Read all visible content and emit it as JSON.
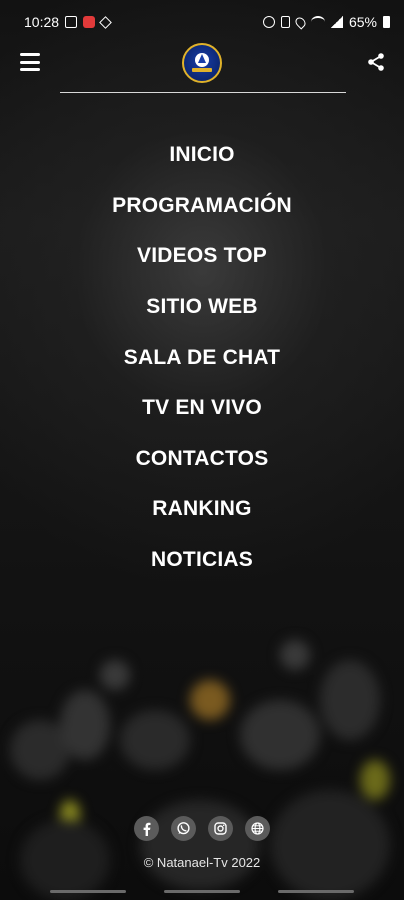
{
  "status_bar": {
    "time": "10:28",
    "battery": "65%"
  },
  "toolbar": {
    "menu_icon": "hamburger-menu-icon",
    "logo_icon": "natanael-tv-logo",
    "share_icon": "share-icon"
  },
  "menu": {
    "items": [
      {
        "label": "INICIO"
      },
      {
        "label": "PROGRAMACIÓN"
      },
      {
        "label": "VIDEOS TOP"
      },
      {
        "label": "SITIO WEB"
      },
      {
        "label": "SALA DE CHAT"
      },
      {
        "label": "TV EN VIVO"
      },
      {
        "label": "CONTACTOS"
      },
      {
        "label": "RANKING"
      },
      {
        "label": "NOTICIAS"
      }
    ]
  },
  "social": {
    "icons": [
      "facebook-icon",
      "whatsapp-icon",
      "instagram-icon",
      "globe-icon"
    ]
  },
  "footer": {
    "copyright": "© Natanael-Tv 2022"
  },
  "colors": {
    "background": "#121212",
    "text": "#ffffff",
    "social_circle": "#5b5b5b",
    "logo_blue": "#1a3ea8",
    "logo_gold": "#e0b22a"
  }
}
